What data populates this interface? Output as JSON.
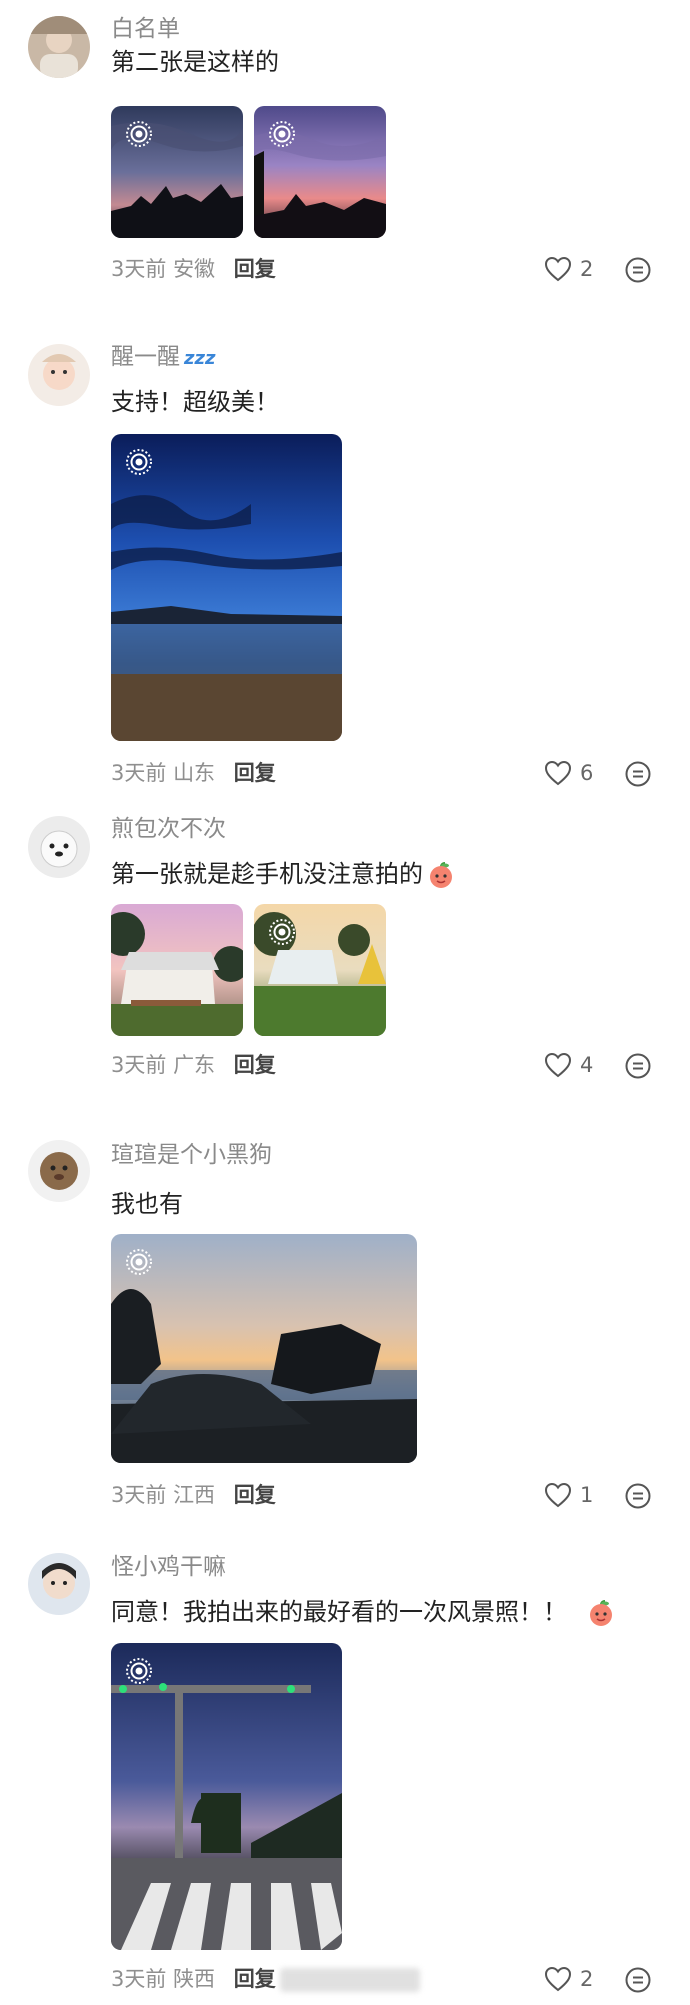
{
  "comments": [
    {
      "username": "白名单",
      "text": "第二张是这样的",
      "time": "3天前",
      "location": "安徽",
      "reply": "回复",
      "likes": "2"
    },
    {
      "username": "醒一醒",
      "text": "支持！超级美！",
      "time": "3天前",
      "location": "山东",
      "reply": "回复",
      "likes": "6"
    },
    {
      "username": "煎包次不次",
      "text": "第一张就是趁手机没注意拍的",
      "time": "3天前",
      "location": "广东",
      "reply": "回复",
      "likes": "4"
    },
    {
      "username": "瑄瑄是个小黑狗",
      "text": "我也有",
      "time": "3天前",
      "location": "江西",
      "reply": "回复",
      "likes": "1"
    },
    {
      "username": "怪小鸡干嘛",
      "text": "同意！我拍出来的最好看的一次风景照！！",
      "time": "3天前",
      "location": "陕西",
      "reply": "回复",
      "likes": "2"
    }
  ],
  "colors": {
    "text": "#222222",
    "meta": "#8f8f8f",
    "username": "#8a8a8a"
  },
  "icons": [
    "heart-icon",
    "more-options-icon",
    "live-photo-icon",
    "peach-emoji-icon"
  ]
}
